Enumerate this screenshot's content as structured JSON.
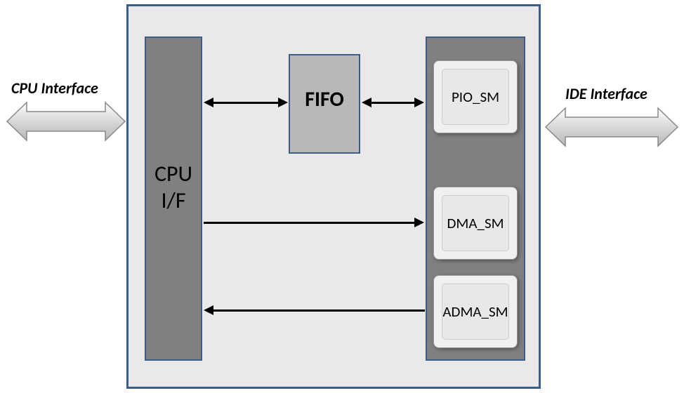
{
  "external_labels": {
    "cpu": "CPU Interface",
    "ide": "IDE Interface"
  },
  "blocks": {
    "cpu_if_line1": "CPU",
    "cpu_if_line2": "I/F",
    "fifo": "FIFO",
    "pio_sm": "PIO_SM",
    "dma_sm": "DMA_SM",
    "adma_sm": "ADMA_SM"
  }
}
